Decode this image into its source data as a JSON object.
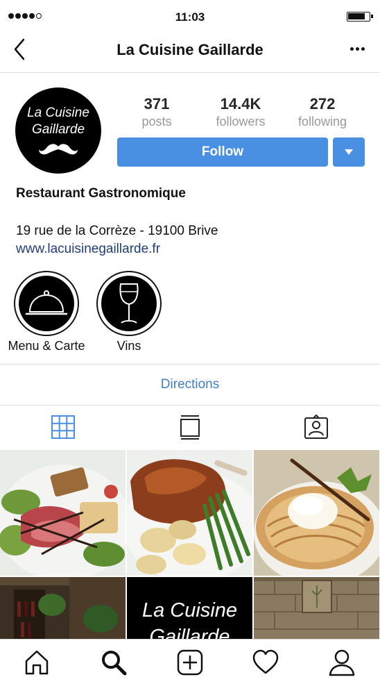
{
  "status_bar": {
    "time": "11:03"
  },
  "header": {
    "title": "La Cuisine Gaillarde"
  },
  "profile": {
    "avatar_line1": "La Cuisine",
    "avatar_line2": "Gaillarde",
    "stats": [
      {
        "value": "371",
        "label": "posts"
      },
      {
        "value": "14.4K",
        "label": "followers"
      },
      {
        "value": "272",
        "label": "following"
      }
    ],
    "follow_label": "Follow"
  },
  "bio": {
    "name": "Restaurant Gastronomique",
    "address": "19 rue de la Corrèze - 19100 Brive",
    "link": "www.lacuisinegaillarde.fr"
  },
  "highlights": [
    {
      "label": "Menu & Carte",
      "icon": "cloche-icon"
    },
    {
      "label": "Vins",
      "icon": "wine-glass-icon"
    }
  ],
  "directions_label": "Directions",
  "tabs": [
    {
      "name": "grid-icon",
      "active": true
    },
    {
      "name": "list-icon",
      "active": false
    },
    {
      "name": "tagged-icon",
      "active": false
    }
  ],
  "grid_posts": [
    {
      "subject": "salad"
    },
    {
      "subject": "duck-confit"
    },
    {
      "subject": "apple-tart"
    },
    {
      "subject": "wine-cellar"
    },
    {
      "subject": "logo",
      "line1": "La Cuisine",
      "line2": "Gaillarde"
    },
    {
      "subject": "stone-wall"
    }
  ],
  "bottom_nav": [
    "home-icon",
    "search-icon",
    "add-post-icon",
    "activity-icon",
    "profile-icon"
  ],
  "colors": {
    "accent": "#4a90e2",
    "link": "#3f7fc4",
    "muted": "#999999"
  }
}
